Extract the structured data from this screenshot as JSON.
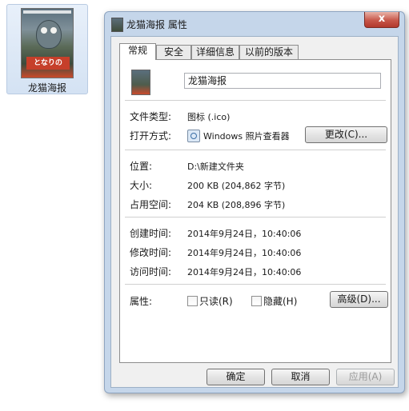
{
  "desktop": {
    "file_label": "龙猫海报"
  },
  "dialog": {
    "title": "龙猫海报 属性",
    "close_glyph": "x",
    "tabs": [
      {
        "label": "常规"
      },
      {
        "label": "安全"
      },
      {
        "label": "详细信息"
      },
      {
        "label": "以前的版本"
      }
    ],
    "file_name": "龙猫海报",
    "fields": {
      "type_label": "文件类型:",
      "type_value": "图标 (.ico)",
      "opens_label": "打开方式:",
      "opens_value": "Windows 照片查看器",
      "change_button": "更改(C)...",
      "location_label": "位置:",
      "location_value": "D:\\新建文件夹",
      "size_label": "大小:",
      "size_value": "200 KB (204,862 字节)",
      "disk_label": "占用空间:",
      "disk_value": "204 KB (208,896 字节)",
      "created_label": "创建时间:",
      "created_value": "2014年9月24日，10:40:06",
      "modified_label": "修改时间:",
      "modified_value": "2014年9月24日，10:40:06",
      "accessed_label": "访问时间:",
      "accessed_value": "2014年9月24日，10:40:06",
      "attributes_label": "属性:",
      "readonly_label": "只读(R)",
      "hidden_label": "隐藏(H)",
      "advanced_button": "高级(D)..."
    },
    "buttons": {
      "ok": "确定",
      "cancel": "取消",
      "apply": "应用(A)"
    }
  }
}
